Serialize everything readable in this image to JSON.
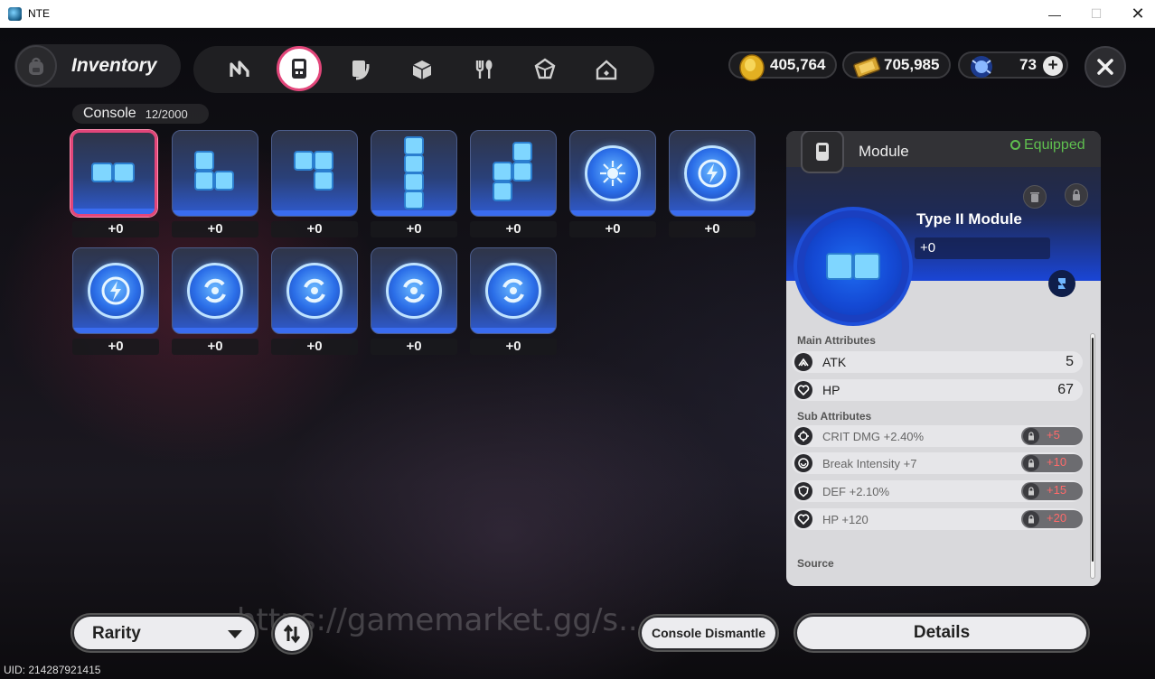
{
  "window": {
    "title": "NTE",
    "minimize": "—",
    "maximize": "☐",
    "close": "✕"
  },
  "header": {
    "title": "Inventory"
  },
  "tabs": [
    {
      "icon": "n-logo-icon"
    },
    {
      "icon": "console-icon",
      "active": true
    },
    {
      "icon": "book-icon"
    },
    {
      "icon": "box-icon"
    },
    {
      "icon": "fork-spoon-icon"
    },
    {
      "icon": "gem-icon"
    },
    {
      "icon": "home-icon"
    }
  ],
  "currencies": [
    {
      "icon": "gold-coin-icon",
      "value": "405,764"
    },
    {
      "icon": "ticket-icon",
      "value": "705,985"
    },
    {
      "icon": "orb-icon",
      "value": "73",
      "plus": "+"
    }
  ],
  "console": {
    "label": "Console",
    "count": "12/2000"
  },
  "items": [
    {
      "glyph": "block-2h",
      "level": "+0",
      "selected": true
    },
    {
      "glyph": "block-l",
      "level": "+0"
    },
    {
      "glyph": "block-j",
      "level": "+0"
    },
    {
      "glyph": "block-i",
      "level": "+0"
    },
    {
      "glyph": "block-s",
      "level": "+0"
    },
    {
      "glyph": "compass-coin",
      "level": "+0"
    },
    {
      "glyph": "bolt-coin",
      "level": "+0"
    },
    {
      "glyph": "bolt-coin",
      "level": "+0"
    },
    {
      "glyph": "cycle-coin",
      "level": "+0"
    },
    {
      "glyph": "cycle-coin",
      "level": "+0"
    },
    {
      "glyph": "cycle-coin",
      "level": "+0"
    },
    {
      "glyph": "cycle-coin",
      "level": "+0"
    }
  ],
  "panel": {
    "name": "Module",
    "status": "Equipped",
    "type_title": "Type II Module",
    "level": "+0",
    "main_label": "Main Attributes",
    "main": [
      {
        "icon": "atk-icon",
        "name": "ATK",
        "value": "5"
      },
      {
        "icon": "hp-icon",
        "name": "HP",
        "value": "67"
      }
    ],
    "sub_label": "Sub Attributes",
    "sub": [
      {
        "icon": "crit-icon",
        "name": "CRIT DMG +2.40%",
        "boost": "+5"
      },
      {
        "icon": "break-icon",
        "name": "Break Intensity +7",
        "boost": "+10"
      },
      {
        "icon": "def-icon",
        "name": "DEF +2.10%",
        "boost": "+15"
      },
      {
        "icon": "hp-icon",
        "name": "HP +120",
        "boost": "+20"
      }
    ],
    "source_label": "Source"
  },
  "bottom": {
    "rarity": "Rarity",
    "dismantle": "Console Dismantle",
    "details": "Details"
  },
  "watermark": "https://gamemarket.gg/s...",
  "uid": "UID: 214287921415"
}
